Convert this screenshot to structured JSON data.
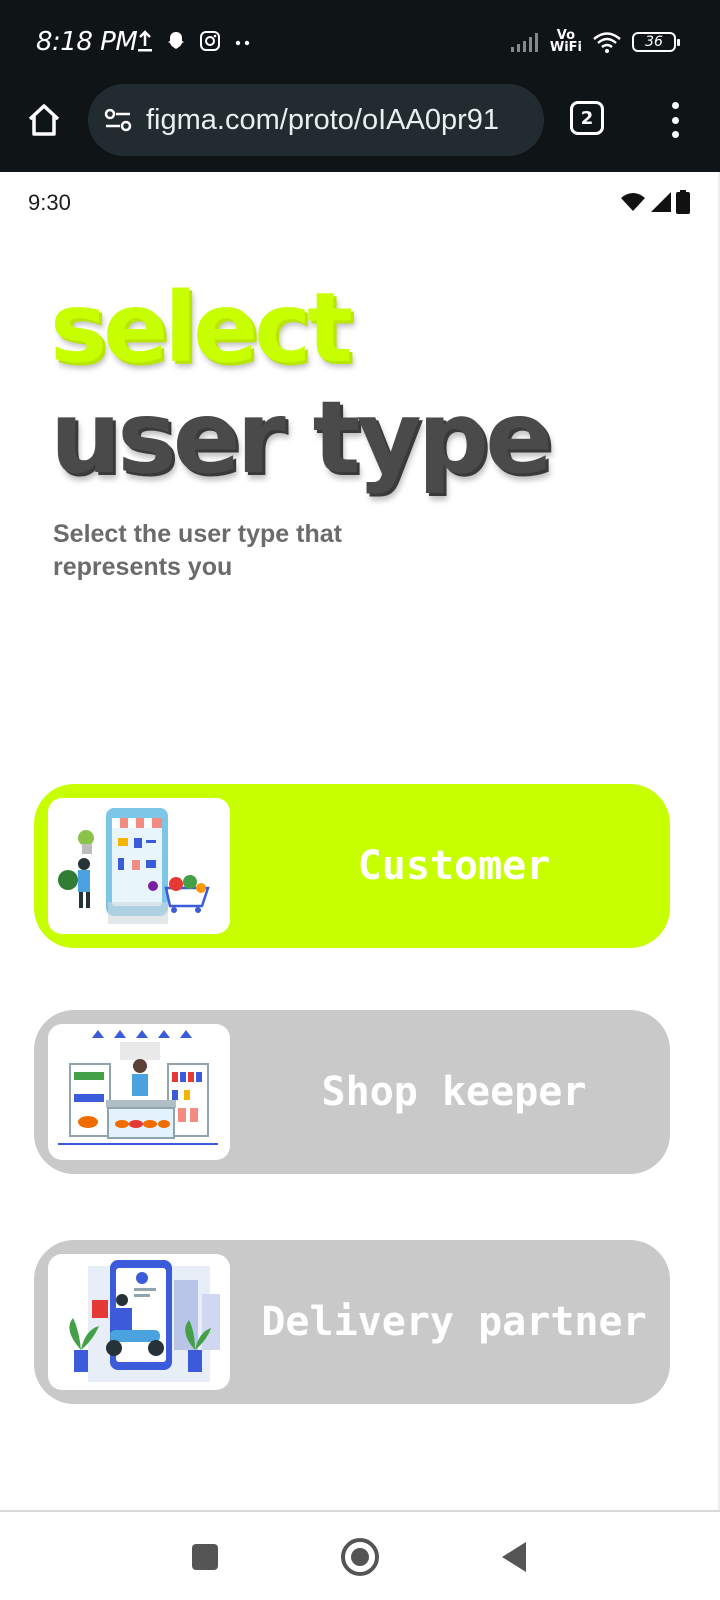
{
  "system_status": {
    "time": "8:18 PM",
    "left_icons": [
      "upload-icon",
      "snapchat-icon",
      "instagram-icon",
      "more-dots-icon"
    ],
    "vo_top": "Vo",
    "vo_bottom": "WiFi",
    "battery": "36"
  },
  "browser": {
    "url": "figma.com/proto/oIAA0pr91",
    "tab_count": "2"
  },
  "app": {
    "time": "9:30",
    "title_line1": "select",
    "title_line2": "user type",
    "subtitle": "Select the user type that represents you",
    "options": [
      {
        "label": "Customer",
        "selected": true,
        "color": "#c8ff00",
        "icon": "customer-illustration"
      },
      {
        "label": "Shop keeper",
        "selected": false,
        "color": "#c9c9c9",
        "icon": "shopkeeper-illustration"
      },
      {
        "label": "Delivery partner",
        "selected": false,
        "color": "#c9c9c9",
        "icon": "delivery-illustration"
      }
    ]
  },
  "nav": {
    "buttons": [
      "recents-button",
      "home-button",
      "back-button"
    ]
  },
  "colors": {
    "accent": "#c8ff00",
    "title_dark": "#4a4a4a",
    "inactive_card": "#c9c9c9",
    "system_bar": "#0f1417"
  }
}
